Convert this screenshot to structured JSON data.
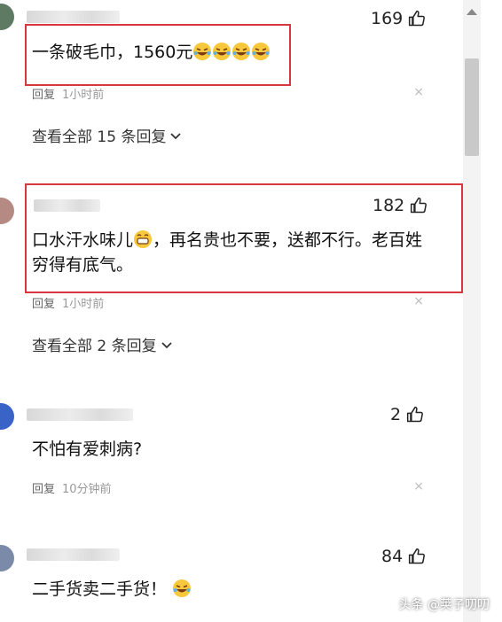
{
  "comments": [
    {
      "likes": "169",
      "text": "一条破毛巾，1560元",
      "reply": "回复",
      "time": "1小时前",
      "view_all": "查看全部 15 条回复"
    },
    {
      "likes": "182",
      "text_line1": "口水汗水味儿",
      "text_line1b": "，再名贵也不要，送都不行。老百姓",
      "text_line2": "穷得有底气。",
      "reply": "回复",
      "time": "1小时前",
      "view_all": "查看全部 2 条回复"
    },
    {
      "likes": "2",
      "text": "不怕有爱刺病?",
      "reply": "回复",
      "time": "10分钟前"
    },
    {
      "likes": "84",
      "text": "二手货卖二手货！"
    }
  ],
  "close_symbol": "×",
  "chevron_symbol": "⌄",
  "watermark": "头条 @荚子叨叨",
  "colors": {
    "highlight_box": "#d9363e",
    "text": "#222222",
    "muted": "#999999"
  },
  "icons": [
    "thumb-up-icon",
    "close-icon",
    "chevron-down-icon",
    "laughing-emoji-icon",
    "grin-emoji-icon"
  ]
}
